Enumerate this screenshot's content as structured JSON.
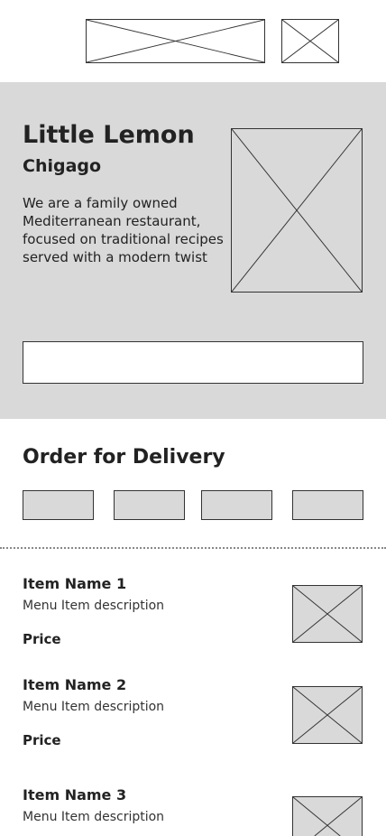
{
  "hero": {
    "title": "Little Lemon",
    "subtitle": "Chigago",
    "description": "We are a family owned Mediterranean restaurant, focused on traditional recipes served with a modern twist",
    "search_value": ""
  },
  "order": {
    "title": "Order for Delivery"
  },
  "menu_items": [
    {
      "name": "Item Name 1",
      "description": "Menu Item description",
      "price": "Price"
    },
    {
      "name": "Item Name 2",
      "description": "Menu Item description",
      "price": "Price"
    },
    {
      "name": "Item Name 3",
      "description": "Menu Item description"
    }
  ],
  "colors": {
    "placeholder_fill": "#d9d9d9",
    "hero_background": "#d9d9d9",
    "outline": "#333333",
    "text": "#222222"
  }
}
